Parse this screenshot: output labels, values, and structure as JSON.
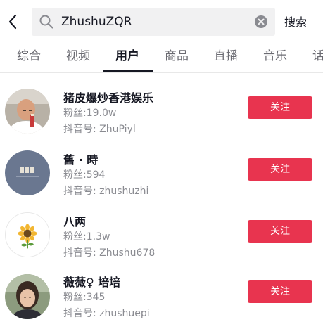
{
  "search": {
    "query": "ZhushuZQR",
    "action_label": "搜索"
  },
  "tabs": [
    {
      "label": "综合"
    },
    {
      "label": "视频"
    },
    {
      "label": "用户"
    },
    {
      "label": "商品"
    },
    {
      "label": "直播"
    },
    {
      "label": "音乐"
    },
    {
      "label": "话"
    }
  ],
  "active_tab": "用户",
  "users": [
    {
      "name": "猪皮爆炒香港娱乐",
      "fans": "粉丝:19.0w",
      "douyin_id": "抖音号: ZhuPiyl",
      "follow_label": "关注"
    },
    {
      "name": "舊 · 時",
      "fans": "粉丝:594",
      "douyin_id": "抖音号: zhushuzhi",
      "follow_label": "关注"
    },
    {
      "name": "八两",
      "fans": "粉丝:1.3w",
      "douyin_id": "抖音号: Zhushu678",
      "follow_label": "关注"
    },
    {
      "name": "薇薇♀ 培培",
      "fans": "粉丝:345",
      "douyin_id": "抖音号: zhushuepi",
      "follow_label": "关注"
    }
  ],
  "colors": {
    "follow_button": "#e8344f",
    "search_background": "#f1f1f2",
    "secondary_text": "#8a8b91"
  }
}
